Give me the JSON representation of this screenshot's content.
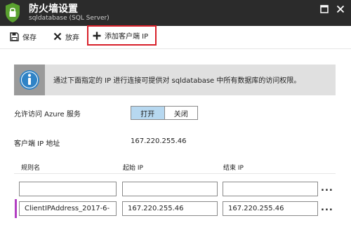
{
  "window": {
    "title": "防火墙设置",
    "subtitle": "sqldatabase (SQL Server)",
    "buttons": [
      "maximize",
      "close"
    ]
  },
  "toolbar": {
    "save_label": "保存",
    "discard_label": "放弃",
    "add_client_ip_label": "添加客户端 IP"
  },
  "info": {
    "message": "通过下面指定的 IP 进行连接可提供对 sqldatabase 中所有数据库的访问权限。"
  },
  "azure_services": {
    "label": "允许访问 Azure 服务",
    "on_label": "打开",
    "off_label": "关闭",
    "selected": "打开"
  },
  "client_ip": {
    "label": "客户端 IP 地址",
    "value": "167.220.255.46"
  },
  "rules_table": {
    "columns": [
      "规则名",
      "起始 IP",
      "结束 IP"
    ],
    "rows": [
      {
        "name": "",
        "start_ip": "",
        "end_ip": ""
      },
      {
        "name": "ClientIPAddress_2017-6-",
        "start_ip": "167.220.255.46",
        "end_ip": "167.220.255.46"
      }
    ],
    "more_label": "..."
  },
  "colors": {
    "titlebar": "#2b2b2b",
    "highlight_border": "#d8202a",
    "toggle_selected": "#b7d8f0",
    "info_bg": "#e0e0e0",
    "info_icon_bg": "#9a9a9a",
    "row_accent": "#b23fc2"
  },
  "icons": [
    "firewall-shield-icon",
    "maximize-icon",
    "close-icon",
    "save-icon",
    "discard-icon",
    "add-icon",
    "info-icon"
  ]
}
